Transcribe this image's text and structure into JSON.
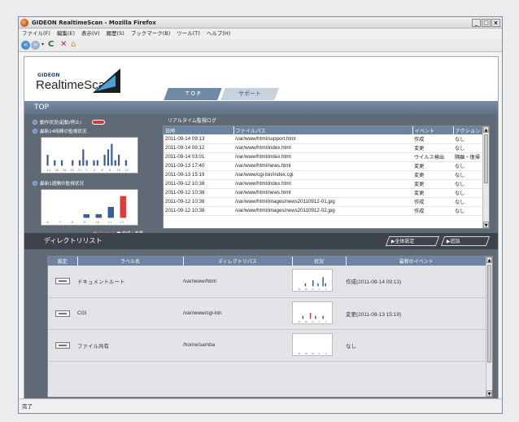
{
  "window": {
    "title": "GIDEON RealtimeScan - Mozilla Firefox",
    "min": "_",
    "max": "□",
    "close": "x"
  },
  "menu": [
    "ファイル(F)",
    "編集(E)",
    "表示(V)",
    "履歴(S)",
    "ブックマーク(B)",
    "ツール(T)",
    "ヘルプ(H)"
  ],
  "nav": {
    "back": "<",
    "forward": ">",
    "dropdown": "▾",
    "reload": "C",
    "stop": "✕",
    "home": "⌂"
  },
  "app": {
    "brand_small": "GIDEON",
    "brand_big": "RealtimeScan",
    "tabs": [
      "T O P",
      "サポート"
    ],
    "page_title": "TOP"
  },
  "left": {
    "status_label": "動作状況(起動/停止)",
    "chart24_label": "最新24時間の監視状況",
    "chart24_ticks": [
      "14",
      "16",
      "18",
      "20",
      "22",
      "2",
      "4",
      "6",
      "8",
      "10",
      "12"
    ],
    "chart24_values": [
      2,
      0,
      1,
      0,
      1,
      0,
      0,
      1,
      0,
      1,
      3,
      1,
      0,
      1,
      1,
      0,
      2,
      3,
      4,
      1,
      2,
      0,
      1,
      0
    ],
    "chartweek_label": "最新1週間の監視状況",
    "chartweek_ticks": [
      "6",
      "7",
      "8",
      "9",
      "10",
      "11",
      "12"
    ],
    "chartweek_values": [
      0,
      0,
      0,
      1,
      1,
      3,
      6
    ],
    "legend_virus": "■:ウイルス",
    "legend_change": "■:作成・変更"
  },
  "log": {
    "title": "リアルタイム監視ログ",
    "headers": [
      "日時",
      "ファイルパス",
      "イベント",
      "アクション"
    ],
    "rows": [
      [
        "2011-09-14 09:13",
        "/var/www/html/support.html",
        "作成",
        "なし"
      ],
      [
        "2011-09-14 09:12",
        "/var/www/html/index.html",
        "変更",
        "なし"
      ],
      [
        "2011-09-14 03:01",
        "/var/www/html/index.html",
        "ウイルス検出",
        "隔離・復帰"
      ],
      [
        "2011-09-13 17:40",
        "/var/www/html/news.html",
        "変更",
        "なし"
      ],
      [
        "2011-09-13 15:19",
        "/var/www/cgi-bin/index.cgi",
        "変更",
        "なし"
      ],
      [
        "2011-09-12 10:38",
        "/var/www/html/index.html",
        "変更",
        "なし"
      ],
      [
        "2011-09-12 10:38",
        "/var/www/html/news.html",
        "変更",
        "なし"
      ],
      [
        "2011-09-12 10:38",
        "/var/www/html/images/news20110912-01.jpg",
        "作成",
        "なし"
      ],
      [
        "2011-09-12 10:38",
        "/var/www/html/images/news20110912-02.jpg",
        "作成",
        "なし"
      ]
    ]
  },
  "dirlist": {
    "title": "ディレクトリリスト",
    "btn_settings": "▶全体設定",
    "btn_add": "▶追加",
    "headers": [
      "設定",
      "ラベル名",
      "ディレクトリパス",
      "状況",
      "最新のイベント"
    ],
    "rows": [
      {
        "label": "ドキュメントルート",
        "path": "/var/www/html",
        "event": "作成(2011-09-14 09:13)",
        "values": [
          0,
          0,
          0,
          1,
          0,
          0,
          2,
          0,
          1,
          0,
          3,
          1
        ]
      },
      {
        "label": "CGI",
        "path": "/var/www/cgi-bin",
        "event": "変更(2011-09-13 15:19)",
        "values": [
          0,
          0,
          1,
          0,
          0,
          2,
          0,
          1,
          0,
          0,
          1,
          0
        ]
      },
      {
        "label": "ファイル共有",
        "path": "/home/samba",
        "event": "なし",
        "values": [
          0,
          0,
          0,
          0,
          0,
          0,
          0,
          0,
          0,
          0,
          0,
          0
        ]
      }
    ],
    "spark_ticks": [
      "24",
      "18",
      "12",
      "6",
      "0"
    ]
  },
  "status": "完了",
  "colors": {
    "accent_blue": "#6d83a1",
    "panel": "#606a76",
    "virus_red": "#e03a3a",
    "change_blue": "#3a5a9a"
  }
}
